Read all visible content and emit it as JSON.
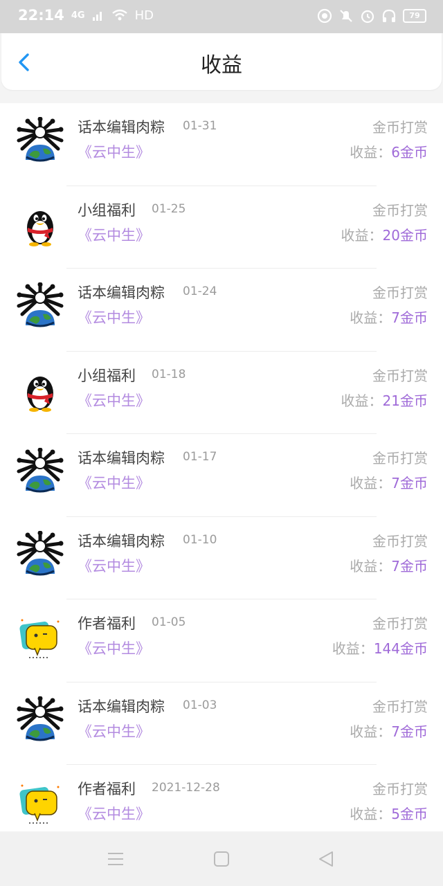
{
  "status": {
    "time": "22:14",
    "network": "4G",
    "hd": "HD",
    "battery": "79"
  },
  "header": {
    "title": "收益"
  },
  "rows": [
    {
      "name": "话本编辑肉粽",
      "date": "01-31",
      "book": "《云中生》",
      "type": "金币打赏",
      "earn_prefix": "收益：",
      "earn_amount": "6金币",
      "avatar": "spiky-globe-avatar"
    },
    {
      "name": "小组福利",
      "date": "01-25",
      "book": "《云中生》",
      "type": "金币打赏",
      "earn_prefix": "收益：",
      "earn_amount": "20金币",
      "avatar": "penguin-avatar"
    },
    {
      "name": "话本编辑肉粽",
      "date": "01-24",
      "book": "《云中生》",
      "type": "金币打赏",
      "earn_prefix": "收益：",
      "earn_amount": "7金币",
      "avatar": "spiky-globe-avatar"
    },
    {
      "name": "小组福利",
      "date": "01-18",
      "book": "《云中生》",
      "type": "金币打赏",
      "earn_prefix": "收益：",
      "earn_amount": "21金币",
      "avatar": "penguin-avatar"
    },
    {
      "name": "话本编辑肉粽",
      "date": "01-17",
      "book": "《云中生》",
      "type": "金币打赏",
      "earn_prefix": "收益：",
      "earn_amount": "7金币",
      "avatar": "spiky-globe-avatar"
    },
    {
      "name": "话本编辑肉粽",
      "date": "01-10",
      "book": "《云中生》",
      "type": "金币打赏",
      "earn_prefix": "收益：",
      "earn_amount": "7金币",
      "avatar": "spiky-globe-avatar"
    },
    {
      "name": "作者福利",
      "date": "01-05",
      "book": "《云中生》",
      "type": "金币打赏",
      "earn_prefix": "收益：",
      "earn_amount": "144金币",
      "avatar": "chat-bubble-avatar"
    },
    {
      "name": "话本编辑肉粽",
      "date": "01-03",
      "book": "《云中生》",
      "type": "金币打赏",
      "earn_prefix": "收益：",
      "earn_amount": "7金币",
      "avatar": "spiky-globe-avatar"
    },
    {
      "name": "作者福利",
      "date": "2021-12-28",
      "book": "《云中生》",
      "type": "金币打赏",
      "earn_prefix": "收益：",
      "earn_amount": "5金币",
      "avatar": "chat-bubble-avatar"
    }
  ],
  "nav": {
    "menu_icon": "menu-icon",
    "home_icon": "square-icon",
    "back_icon": "triangle-back-icon"
  },
  "colors": {
    "accent": "#9f6ad8",
    "book_link": "#b38be0",
    "back_arrow": "#2196f3",
    "status_bar": "#d6d6d6"
  }
}
